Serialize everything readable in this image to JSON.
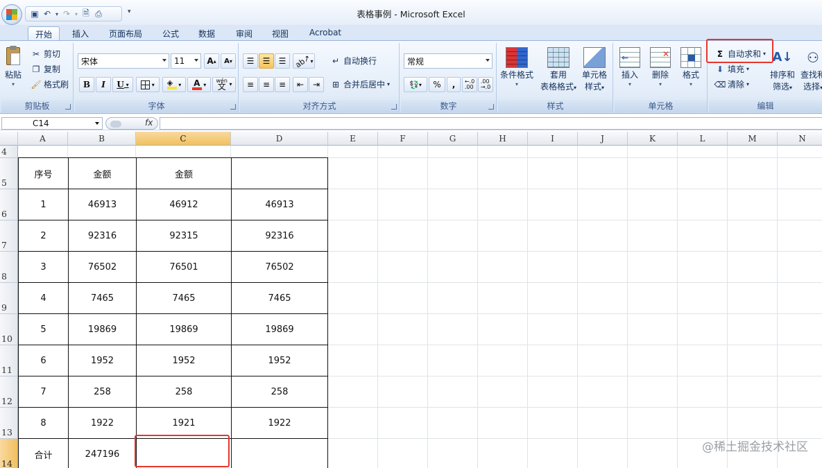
{
  "window": {
    "title": "表格事例 - Microsoft Excel"
  },
  "tabs": [
    "开始",
    "插入",
    "页面布局",
    "公式",
    "数据",
    "审阅",
    "视图",
    "Acrobat"
  ],
  "clipboard": {
    "paste": "粘贴",
    "cut": "剪切",
    "copy": "复制",
    "format_painter": "格式刷",
    "label": "剪贴板"
  },
  "font": {
    "name": "宋体",
    "size": "11",
    "label": "字体",
    "bold": "B",
    "italic": "I",
    "underline": "U",
    "grow": "A",
    "shrink": "A",
    "wen": "wén\n文",
    "font_color": "#e8352b",
    "fill_color": "#f7e43f"
  },
  "alignment": {
    "wrap": "自动换行",
    "merge": "合并后居中",
    "label": "对齐方式"
  },
  "number": {
    "format": "常规",
    "percent": "%",
    "comma": ",",
    "inc": ".0\n.00",
    "dec": ".00\n.0",
    "label": "数字"
  },
  "styles": {
    "conditional": "条件格式",
    "table_format_1": "套用",
    "table_format_2": "表格格式",
    "cell_style_1": "单元格",
    "cell_style_2": "样式",
    "label": "样式"
  },
  "cells": {
    "insert": "插入",
    "delete": "删除",
    "format": "格式",
    "label": "单元格"
  },
  "editing": {
    "autosum": "自动求和",
    "sigma": "Σ",
    "fill": "填充",
    "clear": "清除",
    "sort_1": "排序和",
    "sort_2": "筛选",
    "find_1": "查找和",
    "find_2": "选择",
    "label": "编辑"
  },
  "formula_bar": {
    "name_box": "C14",
    "fx": "fx",
    "value": ""
  },
  "columns": [
    "A",
    "B",
    "C",
    "D",
    "E",
    "F",
    "G",
    "H",
    "I",
    "J",
    "K",
    "L",
    "M",
    "N"
  ],
  "selected_column": "C",
  "selected_row": "14",
  "rows": [
    "4",
    "5",
    "6",
    "7",
    "8",
    "9",
    "10",
    "11",
    "12",
    "13",
    "14"
  ],
  "table": {
    "header": [
      "序号",
      "金额",
      "金额",
      ""
    ],
    "body": [
      [
        "1",
        "46913",
        "46912",
        "46913"
      ],
      [
        "2",
        "92316",
        "92315",
        "92316"
      ],
      [
        "3",
        "76502",
        "76501",
        "76502"
      ],
      [
        "4",
        "7465",
        "7465",
        "7465"
      ],
      [
        "5",
        "19869",
        "19869",
        "19869"
      ],
      [
        "6",
        "1952",
        "1952",
        "1952"
      ],
      [
        "7",
        "258",
        "258",
        "258"
      ],
      [
        "8",
        "1922",
        "1921",
        "1922"
      ],
      [
        "合计",
        "247196",
        "",
        ""
      ]
    ]
  },
  "watermark": "@稀土掘金技术社区",
  "colors": {
    "highlight": "#e8352b",
    "accent": "#2a5aa8"
  }
}
